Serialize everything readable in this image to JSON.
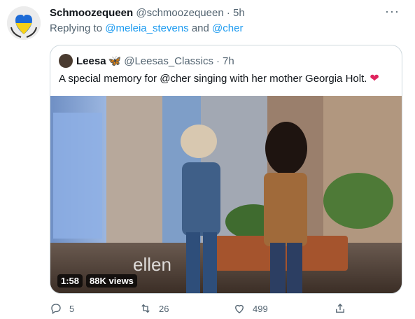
{
  "tweet": {
    "display_name": "Schmoozequeen",
    "handle": "@schmoozequeen",
    "separator": "·",
    "time": "5h",
    "more_label": "···",
    "replying_prefix": "Replying to",
    "mention1": "@meleia_stevens",
    "and_word": "and",
    "mention2": "@cher"
  },
  "quoted": {
    "display_name": "Leesa",
    "emoji": "🦋",
    "handle": "@Leesas_Classics",
    "separator": "·",
    "time": "7h",
    "text": "A special memory for @cher singing with her mother Georgia Holt.",
    "heart": "❤",
    "video": {
      "duration": "1:58",
      "views": "88K views",
      "watermark": "ellen"
    }
  },
  "actions": {
    "replies": "5",
    "retweets": "26",
    "likes": "499"
  },
  "colors": {
    "link": "#1d9bf0",
    "secondary_text": "#536471",
    "border": "#cfd9de",
    "heart": "#e0245e"
  },
  "icons": [
    "reply-icon",
    "retweet-icon",
    "like-icon",
    "share-icon",
    "more-icon",
    "butterfly-emoji",
    "heart-emoji"
  ]
}
